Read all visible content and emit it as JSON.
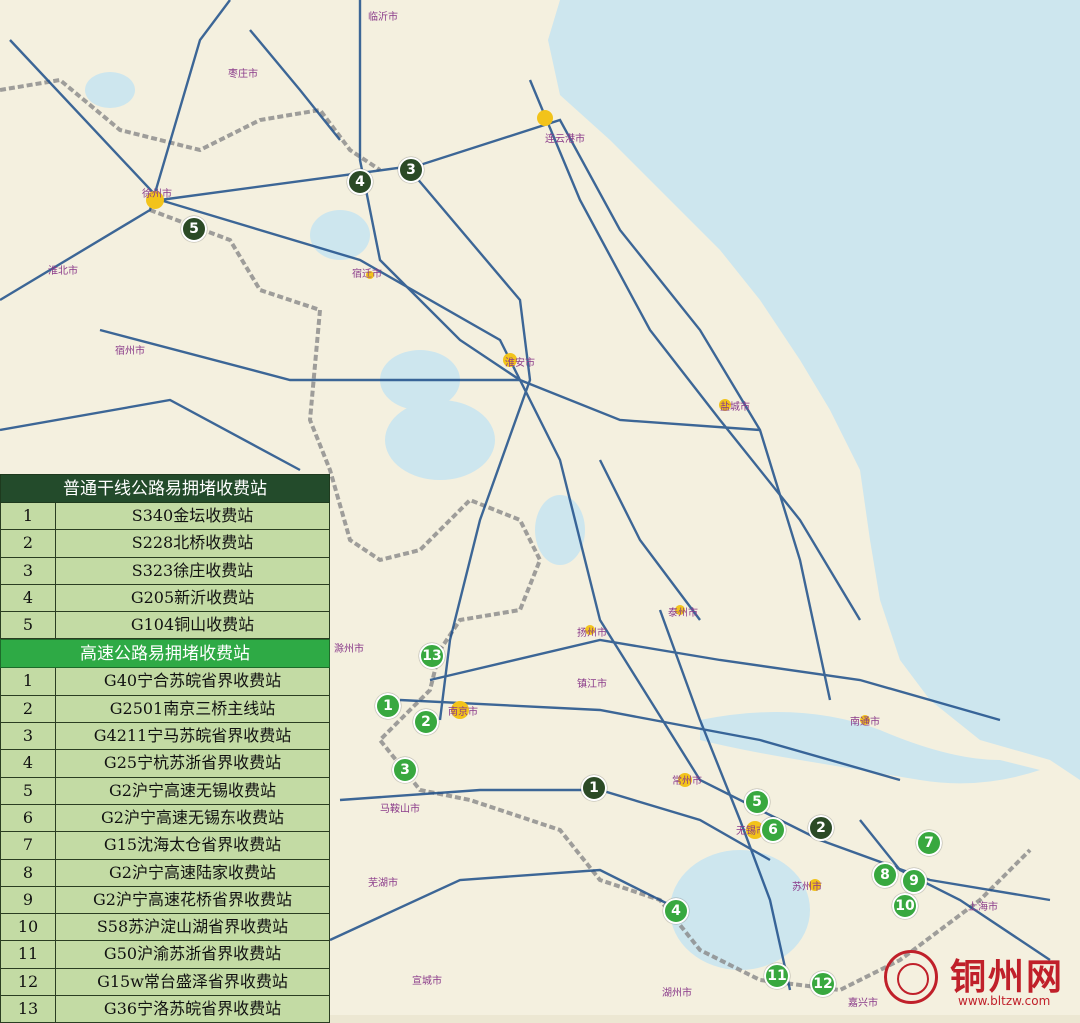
{
  "legend": {
    "arterial": {
      "title": "普通干线公路易拥堵收费站",
      "items": [
        {
          "num": "1",
          "name": "S340金坛收费站"
        },
        {
          "num": "2",
          "name": "S228北桥收费站"
        },
        {
          "num": "3",
          "name": "S323徐庄收费站"
        },
        {
          "num": "4",
          "name": "G205新沂收费站"
        },
        {
          "num": "5",
          "name": "G104铜山收费站"
        }
      ]
    },
    "expressway": {
      "title": "高速公路易拥堵收费站",
      "items": [
        {
          "num": "1",
          "name": "G40宁合苏皖省界收费站"
        },
        {
          "num": "2",
          "name": "G2501南京三桥主线站"
        },
        {
          "num": "3",
          "name": "G4211宁马苏皖省界收费站"
        },
        {
          "num": "4",
          "name": "G25宁杭苏浙省界收费站"
        },
        {
          "num": "5",
          "name": "G2沪宁高速无锡收费站"
        },
        {
          "num": "6",
          "name": "G2沪宁高速无锡东收费站"
        },
        {
          "num": "7",
          "name": "G15沈海太仓省界收费站"
        },
        {
          "num": "8",
          "name": "G2沪宁高速陆家收费站"
        },
        {
          "num": "9",
          "name": "G2沪宁高速花桥省界收费站"
        },
        {
          "num": "10",
          "name": "S58苏沪淀山湖省界收费站"
        },
        {
          "num": "11",
          "name": "G50沪渝苏浙省界收费站"
        },
        {
          "num": "12",
          "name": "G15w常台盛泽省界收费站"
        },
        {
          "num": "13",
          "name": "G36宁洛苏皖省界收费站"
        }
      ]
    }
  },
  "markers": {
    "arterial": [
      "1",
      "2",
      "3",
      "4",
      "5"
    ],
    "expressway": [
      "1",
      "2",
      "3",
      "4",
      "5",
      "6",
      "7",
      "8",
      "9",
      "10",
      "11",
      "12",
      "13"
    ]
  },
  "cities": [
    "临沂市",
    "枣庄市",
    "徐州市",
    "连云港市",
    "宿迁市",
    "淮北市",
    "宿州市",
    "淮安市",
    "盐城市",
    "扬州市",
    "泰州市",
    "镇江市",
    "南京市",
    "南通市",
    "马鞍山市",
    "常州市",
    "无锡市",
    "苏州市",
    "上海市",
    "芜湖市",
    "宣城市",
    "湖州市",
    "嘉兴市",
    "滁州市"
  ],
  "watermark": {
    "title": "铜州网",
    "url": "www.bltzw.com"
  },
  "colors": {
    "sea": "#cde6ee",
    "land": "#f4f0df",
    "expressway": "#1d4e8a",
    "arterial_marker": "#2b4a26",
    "expressway_marker": "#38a83f",
    "border": "#888888"
  }
}
